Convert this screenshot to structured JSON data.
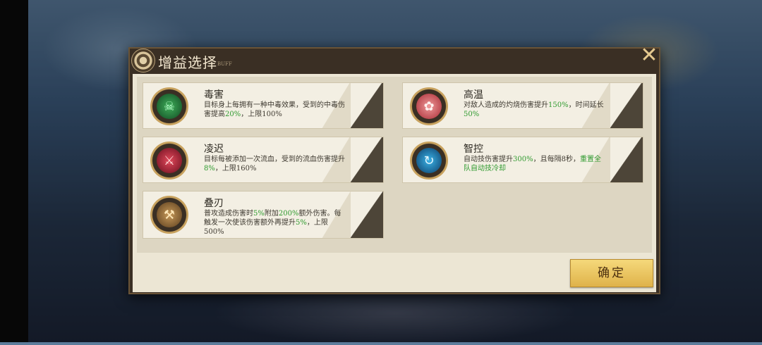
{
  "dialog": {
    "title": "增益选择",
    "title_sub": "BUFF",
    "close_glyph": "✕",
    "confirm_label": "确定"
  },
  "buffs": [
    {
      "name": "毒害",
      "icon": "poison-icon",
      "glyph": "☠",
      "desc": [
        {
          "t": "目标身上每拥有一种中毒效果，受到的中毒伤害提高"
        },
        {
          "t": "20%",
          "hl": true
        },
        {
          "t": "，上限100%"
        }
      ]
    },
    {
      "name": "凌迟",
      "icon": "bleed-claw-icon",
      "glyph": "⚔",
      "desc": [
        {
          "t": "目标每被添加一次流血，受到的流血伤害提升"
        },
        {
          "t": "8%",
          "hl": true
        },
        {
          "t": "，上限160%"
        }
      ]
    },
    {
      "name": "叠刃",
      "icon": "stacked-blades-icon",
      "glyph": "⚒",
      "desc": [
        {
          "t": "普攻造成伤害时"
        },
        {
          "t": "5%",
          "hl": true
        },
        {
          "t": "附加"
        },
        {
          "t": "200%",
          "hl": true
        },
        {
          "t": "额外伤害。每触发一次使该伤害额外再提升"
        },
        {
          "t": "5%",
          "hl": true
        },
        {
          "t": "，上限500%"
        }
      ]
    },
    {
      "name": "高温",
      "icon": "high-temperature-icon",
      "glyph": "✿",
      "desc": [
        {
          "t": "对敌人造成的灼烧伤害提升"
        },
        {
          "t": "150%",
          "hl": true
        },
        {
          "t": "，时间延长"
        },
        {
          "t": "50%",
          "hl": true
        }
      ]
    },
    {
      "name": "智控",
      "icon": "smart-control-icon",
      "glyph": "↻",
      "desc": [
        {
          "t": "自动技伤害提升"
        },
        {
          "t": "300%",
          "hl": true
        },
        {
          "t": "，且每隔8秒，"
        },
        {
          "t": "重置全队自动技冷却",
          "hl": true
        }
      ]
    }
  ],
  "colors": {
    "highlight": "#2f9a2f",
    "confirm_button": "#eac862",
    "panel_bg": "#ece6d4"
  }
}
